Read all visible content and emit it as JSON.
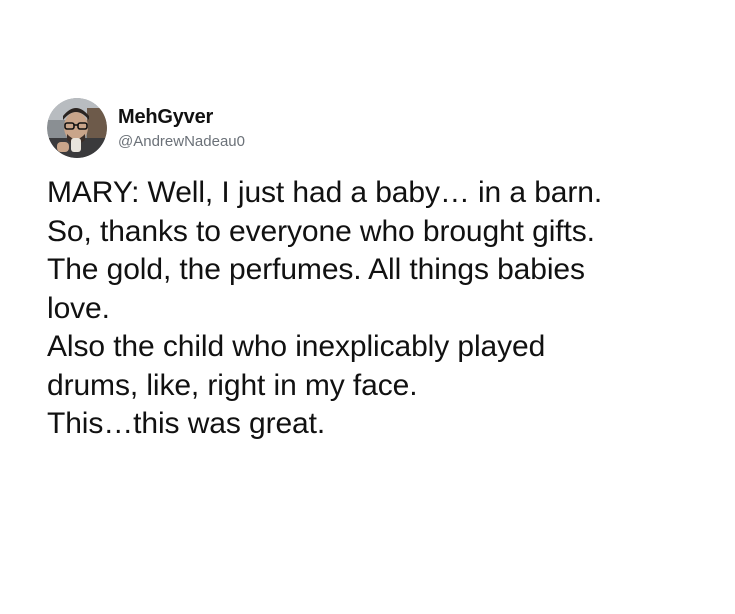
{
  "author": {
    "display_name": "MehGyver",
    "handle": "@AndrewNadeau0",
    "avatar_icon": "profile-photo-icon"
  },
  "tweet": {
    "lines": [
      "MARY: Well, I just had a baby… in a barn.",
      "So, thanks to everyone who brought gifts.",
      "The gold, the perfumes. All things babies",
      "love.",
      "Also the child who inexplicably played",
      "drums, like, right in my face.",
      "This…this was great."
    ]
  },
  "colors": {
    "text": "#111111",
    "handle": "#6b7178",
    "background": "#ffffff"
  }
}
